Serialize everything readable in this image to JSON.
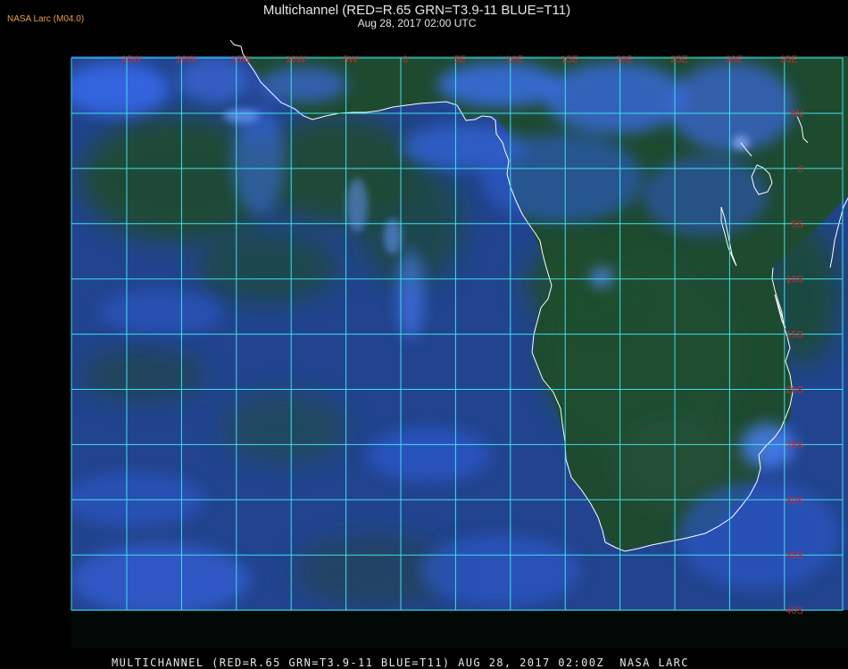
{
  "header": {
    "credit": "NASA Larc (M04.0)",
    "title": "Multichannel (RED=R.65 GRN=T3.9-11 BLUE=T11)",
    "subtitle": "Aug 28, 2017 02:00 UTC"
  },
  "footer": {
    "caption": "MULTICHANNEL (RED=R.65 GRN=T3.9-11 BLUE=T11) AUG 28, 2017 02:00Z  NASA LARC"
  },
  "map": {
    "longitude_labels": [
      "25W",
      "20W",
      "15W",
      "10W",
      "5W",
      "0",
      "5E",
      "10E",
      "15E",
      "20E",
      "25E",
      "30E",
      "35E"
    ],
    "latitude_labels": [
      "5N",
      "0",
      "5S",
      "10S",
      "15S",
      "20S",
      "25S",
      "30S",
      "35S",
      "40S"
    ],
    "colors": {
      "grid": "#3fe0ea",
      "coastline": "#ffffff",
      "grid_label": "#d02828",
      "ocean_cloud": "#2550b0",
      "land": "#1f4a30"
    }
  }
}
